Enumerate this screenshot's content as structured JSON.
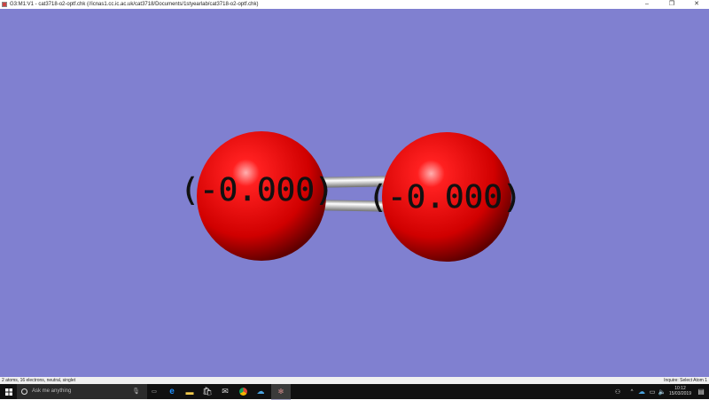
{
  "window": {
    "title": "G3:M1:V1 - cat3718-o2-optf.chk (//icnas1.cc.ic.ac.uk/cat3718/Documents/1styearlab/cat3718-o2-optf.chk)",
    "minimize": "–",
    "maximize": "❐",
    "close": "✕"
  },
  "molecule": {
    "atoms": [
      {
        "element": "O",
        "label": "(-0.000)"
      },
      {
        "element": "O",
        "label": "(-0.000)"
      }
    ],
    "bond_order": 2,
    "atom_color": "#ff0000",
    "background": "#8080d0"
  },
  "status": {
    "left": "2 atoms, 16 electrons, neutral, singlet",
    "right": "Inquire: Select Atom 1"
  },
  "taskbar": {
    "search_placeholder": "Ask me anything",
    "time": "10:12",
    "date": "15/03/2019"
  }
}
